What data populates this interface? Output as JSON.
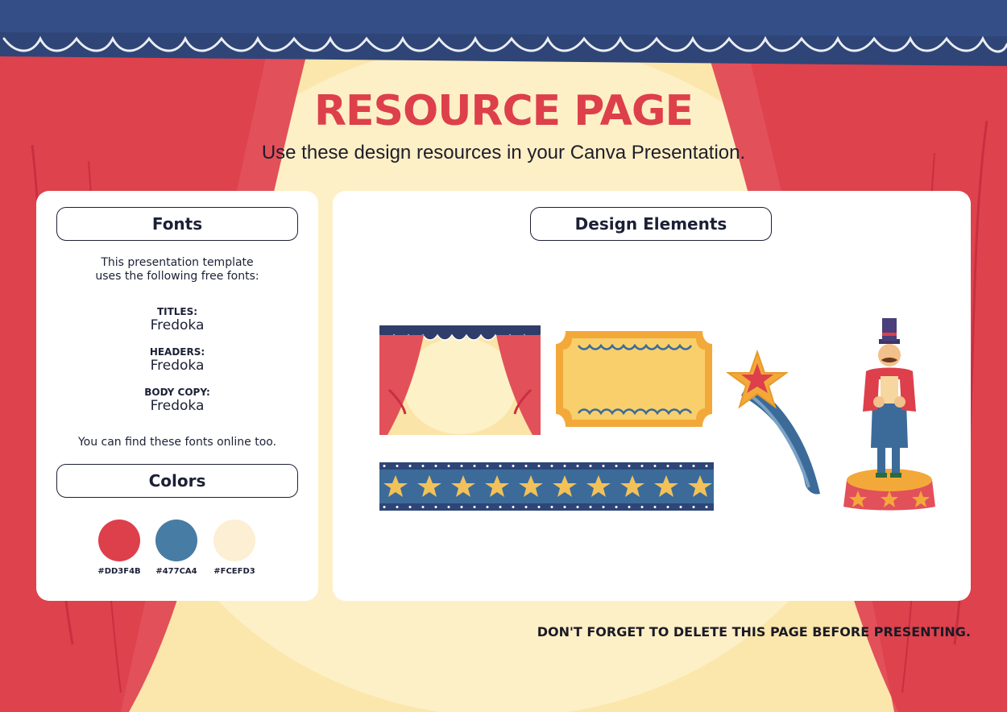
{
  "page": {
    "title": "RESOURCE PAGE",
    "subtitle": "Use these design resources in your Canva Presentation."
  },
  "fonts_card": {
    "heading": "Fonts",
    "intro_line1": "This presentation template",
    "intro_line2": "uses the following free fonts:",
    "fonts": [
      {
        "label": "TITLES:",
        "name": "Fredoka"
      },
      {
        "label": "HEADERS:",
        "name": "Fredoka"
      },
      {
        "label": "BODY COPY:",
        "name": "Fredoka"
      }
    ],
    "note": "You can find these fonts online too."
  },
  "colors_card": {
    "heading": "Colors",
    "swatches": [
      {
        "hex": "#DD3F4B",
        "color": "#dd3f4b"
      },
      {
        "hex": "#477CA4",
        "color": "#477ca4"
      },
      {
        "hex": "#FCEFD3",
        "color": "#fcefd3"
      }
    ]
  },
  "design_card": {
    "heading": "Design Elements",
    "elements": [
      "stage-curtain-icon",
      "ticket-frame-icon",
      "shooting-star-icon",
      "ringmaster-icon",
      "star-banner-icon"
    ]
  },
  "footer": "DON'T FORGET TO DELETE THIS PAGE BEFORE PRESENTING.",
  "theme": {
    "red": "#dd3f4b",
    "blue": "#477ca4",
    "cream": "#fcefd3",
    "navy": "#1c2036"
  }
}
